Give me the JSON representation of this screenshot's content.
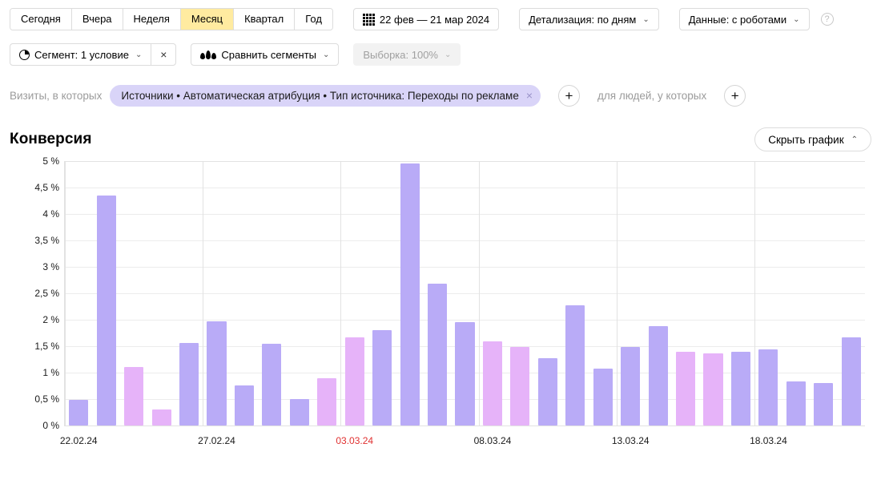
{
  "period_tabs": [
    {
      "label": "Сегодня",
      "active": false
    },
    {
      "label": "Вчера",
      "active": false
    },
    {
      "label": "Неделя",
      "active": false
    },
    {
      "label": "Месяц",
      "active": true
    },
    {
      "label": "Квартал",
      "active": false
    },
    {
      "label": "Год",
      "active": false
    }
  ],
  "date_range": {
    "icon": "calendar-grid-icon",
    "value": "22 фев — 21 мар 2024"
  },
  "detail_select": {
    "label": "Детализация: по дням",
    "chevron": "⌄"
  },
  "data_select": {
    "label": "Данные: с роботами",
    "chevron": "⌄"
  },
  "help": {
    "glyph": "?"
  },
  "segment": {
    "icon": "pie-chart-icon",
    "label": "Сегмент: 1 условие",
    "chevron": "⌄",
    "close_glyph": "×"
  },
  "compare_segments": {
    "icon": "compare-drops-icon",
    "label": "Сравнить сегменты",
    "chevron": "⌄"
  },
  "sampling": {
    "label": "Выборка: 100%",
    "chevron": "⌄",
    "disabled": true
  },
  "filter": {
    "prefix_label": "Визиты, в которых",
    "chip_text": "Источники • Автоматическая атрибуция • Тип источника: Переходы по рекламе",
    "chip_close": "×",
    "add_condition": "+",
    "middle_label": "для людей, у которых",
    "add_people_condition": "+"
  },
  "page_title": "Конверсия",
  "hide_chart_button": {
    "label": "Скрыть график",
    "chevron": "⌃"
  },
  "colors": {
    "bar_weekday": "#b9abf7",
    "bar_weekend": "#e6b3f9",
    "active_tab": "#ffeba0",
    "chip_bg": "#d9d4f8",
    "holiday_text": "#e03131",
    "grid": "#ececec"
  },
  "chart_data": {
    "type": "bar",
    "title": "Конверсия",
    "xlabel": "",
    "ylabel": "",
    "ylim": [
      0,
      5
    ],
    "grid": true,
    "legend": "none",
    "ytick_labels": [
      "0 %",
      "0,5 %",
      "1 %",
      "1,5 %",
      "2 %",
      "2,5 %",
      "3 %",
      "3,5 %",
      "4 %",
      "4,5 %",
      "5 %"
    ],
    "ytick_values": [
      0,
      0.5,
      1,
      1.5,
      2,
      2.5,
      3,
      3.5,
      4,
      4.5,
      5
    ],
    "xtick_labels": [
      {
        "label": "22.02.24",
        "index": 0,
        "holiday": false
      },
      {
        "label": "27.02.24",
        "index": 5,
        "holiday": false
      },
      {
        "label": "03.03.24",
        "index": 10,
        "holiday": true
      },
      {
        "label": "08.03.24",
        "index": 15,
        "holiday": false
      },
      {
        "label": "13.03.24",
        "index": 20,
        "holiday": false
      },
      {
        "label": "18.03.24",
        "index": 25,
        "holiday": false
      }
    ],
    "categories": [
      "22.02.24",
      "23.02.24",
      "24.02.24",
      "25.02.24",
      "26.02.24",
      "27.02.24",
      "28.02.24",
      "29.02.24",
      "01.03.24",
      "02.03.24",
      "03.03.24",
      "04.03.24",
      "05.03.24",
      "06.03.24",
      "07.03.24",
      "08.03.24",
      "09.03.24",
      "10.03.24",
      "11.03.24",
      "12.03.24",
      "13.03.24",
      "14.03.24",
      "15.03.24",
      "16.03.24",
      "17.03.24",
      "18.03.24",
      "19.03.24",
      "20.03.24",
      "21.03.24"
    ],
    "values": [
      0.49,
      4.35,
      1.11,
      0.3,
      1.56,
      1.97,
      0.76,
      1.54,
      0.5,
      0.9,
      1.66,
      1.81,
      4.96,
      2.68,
      1.95,
      1.59,
      1.49,
      1.27,
      2.28,
      1.08,
      1.49,
      1.88,
      1.4,
      1.36,
      1.4,
      1.44,
      0.84,
      0.81,
      1.67
    ],
    "weekend_flags": [
      false,
      false,
      true,
      true,
      false,
      false,
      false,
      false,
      false,
      true,
      true,
      false,
      false,
      false,
      false,
      true,
      true,
      false,
      false,
      false,
      false,
      false,
      true,
      true,
      false,
      false,
      false,
      false,
      false
    ]
  }
}
